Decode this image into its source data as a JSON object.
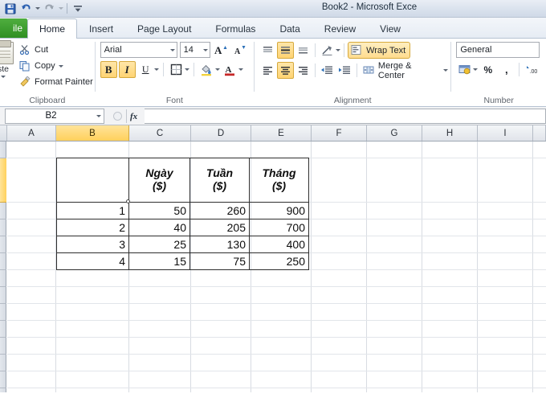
{
  "window": {
    "title": "Book2  -  Microsoft Exce",
    "quick_access": [
      {
        "name": "save-icon",
        "label": "Save"
      },
      {
        "name": "undo-icon",
        "label": "Undo"
      },
      {
        "name": "redo-icon",
        "label": "Redo"
      },
      {
        "name": "customize-qat-icon",
        "label": "Customize Quick Access Toolbar"
      }
    ]
  },
  "tabs": {
    "file_label": "ile",
    "items": [
      {
        "label": "Home",
        "active": true
      },
      {
        "label": "Insert",
        "active": false
      },
      {
        "label": "Page Layout",
        "active": false
      },
      {
        "label": "Formulas",
        "active": false
      },
      {
        "label": "Data",
        "active": false
      },
      {
        "label": "Review",
        "active": false
      },
      {
        "label": "View",
        "active": false
      }
    ]
  },
  "ribbon": {
    "clipboard": {
      "group_label": "Clipboard",
      "paste_label": "ste",
      "cut_label": "Cut",
      "copy_label": "Copy",
      "format_painter_label": "Format Painter",
      "dialog_launcher": "↘"
    },
    "font": {
      "group_label": "Font",
      "font_name": "Arial",
      "font_size": "14",
      "grow_font_label": "A",
      "shrink_font_label": "A",
      "bold_label": "B",
      "italic_label": "I",
      "underline_label": "U",
      "border_label": "▣",
      "fill_color_label": "◔",
      "font_color_label": "A",
      "bold_active": true,
      "italic_active": true,
      "dialog_launcher": "↘"
    },
    "alignment": {
      "group_label": "Alignment",
      "wrap_text_label": "Wrap Text",
      "merge_center_label": "Merge & Center",
      "wrap_text_active": true,
      "align_top_label": "Top Align",
      "align_middle_label": "Middle Align",
      "align_bottom_label": "Bottom Align",
      "orientation_label": "Orientation",
      "align_left_label": "Align Text Left",
      "align_center_label": "Center",
      "align_right_label": "Align Text Right",
      "decrease_indent_label": "Decrease Indent",
      "increase_indent_label": "Increase Indent",
      "dialog_launcher": "↘"
    },
    "number": {
      "group_label": "Number",
      "format": "General",
      "accounting_label": "Accounting Number Format",
      "percent_label": "%",
      "comma_label": ",",
      "decimal_label": ".00",
      "dialog_launcher": "↘"
    }
  },
  "formula_bar": {
    "name_box": "B2",
    "cancel_label": "✕",
    "enter_label": "✓",
    "function_label": "fx",
    "formula_value": ""
  },
  "grid": {
    "columns": [
      "A",
      "B",
      "C",
      "D",
      "E",
      "F",
      "G",
      "H",
      "I"
    ],
    "selected_column": "B",
    "selected_row": 2,
    "selected_cell": "B2"
  },
  "sheet_table": {
    "headers": [
      "",
      "Ngày\n($)",
      "Tuần\n($)",
      "Tháng\n($)"
    ],
    "header_cells": [
      {
        "text": "",
        "kind": "blank"
      },
      {
        "line1": "Ngày",
        "line2": "($)"
      },
      {
        "line1": "Tuần",
        "line2": "($)"
      },
      {
        "line1": "Tháng",
        "line2": "($)"
      }
    ],
    "rows": [
      {
        "label": "1",
        "ngay": "50",
        "tuan": "260",
        "thang": "900"
      },
      {
        "label": "2",
        "ngay": "40",
        "tuan": "205",
        "thang": "700"
      },
      {
        "label": "3",
        "ngay": "25",
        "tuan": "130",
        "thang": "400"
      },
      {
        "label": "4",
        "ngay": "15",
        "tuan": "75",
        "thang": "250"
      }
    ]
  },
  "colors": {
    "accent_green": "#3f9c2d",
    "selection_gold": "#ffd15c",
    "active_toggle": "#ffd473",
    "grid_line": "#d8dce2"
  }
}
